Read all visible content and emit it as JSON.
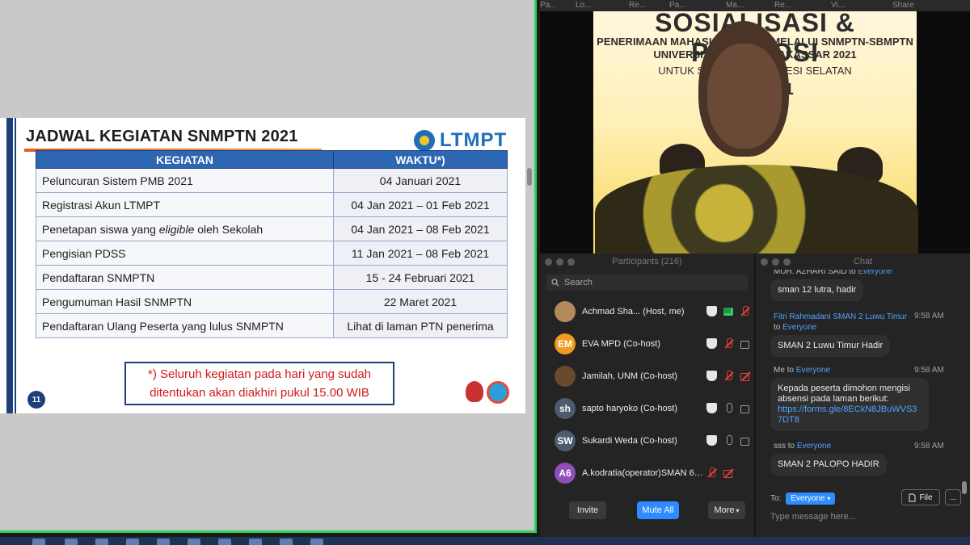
{
  "topstrip": {
    "items": [
      "Pa...",
      "Lo...",
      "Re...",
      "Pa...",
      "Ma...",
      "Re...",
      "Vi...",
      "Share"
    ]
  },
  "slide": {
    "title": "JADWAL KEGIATAN SNMPTN 2021",
    "logo": "LTMPT",
    "page_number": "11",
    "table": {
      "headers": [
        "KEGIATAN",
        "WAKTU*)"
      ],
      "rows": [
        [
          "Peluncuran Sistem PMB 2021",
          "04 Januari 2021"
        ],
        [
          "Registrasi Akun LTMPT",
          "04 Jan 2021 – 01 Feb 2021"
        ],
        [
          "Penetapan siswa yang eligible oleh Sekolah",
          "04 Jan 2021 – 08 Feb 2021"
        ],
        [
          "Pengisian PDSS",
          "11 Jan 2021 – 08 Feb 2021"
        ],
        [
          "Pendaftaran SNMPTN",
          "15 - 24 Februari 2021"
        ],
        [
          "Pengumuman Hasil SNMPTN",
          "22 Maret 2021"
        ],
        [
          "Pendaftaran Ulang Peserta yang lulus SNMPTN",
          "Lihat di laman PTN penerima"
        ]
      ]
    },
    "note_line1": "*) Seluruh kegiatan pada hari yang sudah",
    "note_line2": "ditentukan akan diakhiri pukul 15.00 WIB"
  },
  "video": {
    "banner_line1": "SOSIALISASI & PROMOSI",
    "banner_line2": "PENERIMAAN MAHASISWA BARU MELALUI SNMPTN-SBMPTN",
    "banner_line3": "UNIVERSITAS NEGERI MAKASSAR 2021",
    "banner_line4": "UNTUK SMA/SMK SULAWESI SELATAN",
    "banner_line5": "30-... 2021"
  },
  "participants": {
    "title": "Participants (216)",
    "search_placeholder": "Search",
    "list": [
      {
        "initials": "",
        "name": "Achmad Sha...  (Host, me)",
        "color": "#b58a5a"
      },
      {
        "initials": "EM",
        "name": "EVA MPD (Co-host)",
        "color": "#f29b21"
      },
      {
        "initials": "",
        "name": "Jamilah, UNM (Co-host)",
        "color": "#6a4a2c"
      },
      {
        "initials": "sh",
        "name": "sapto haryoko (Co-host)",
        "color": "#4d5b6c"
      },
      {
        "initials": "SW",
        "name": "Sukardi Weda (Co-host)",
        "color": "#4d5b6c"
      },
      {
        "initials": "A6",
        "name": "A.kodratia(operator)SMAN 6 P...",
        "color": "#8e4fb8"
      }
    ],
    "invite": "Invite",
    "mute_all": "Mute All",
    "more": "More"
  },
  "chat": {
    "title": "Chat",
    "messages": [
      {
        "from": "MUH. AZHARI SAID",
        "to": "Everyone",
        "time": "",
        "text": "sman 12 lutra, hadir"
      },
      {
        "from": "Fitri Rahmadani SMAN 2 Luwu Timur",
        "to": "Everyone",
        "time": "9:58 AM",
        "text": "SMAN 2 Luwu Timur Hadir"
      },
      {
        "from": "Me",
        "to": "Everyone",
        "time": "9:58 AM",
        "text": "Kepada peserta dimohon mengisi absensi pada laman berikut:",
        "link": "https://forms.gle/8ECkN8JBuWVS37DT8"
      },
      {
        "from": "sss",
        "to": "Everyone",
        "time": "9:58 AM",
        "text": "SMAN 2 PALOPO HADIR"
      }
    ],
    "to_label": "To:",
    "to_value": "Everyone",
    "file": "File",
    "more": "...",
    "input_placeholder": "Type message here..."
  },
  "words": {
    "to": "to"
  }
}
